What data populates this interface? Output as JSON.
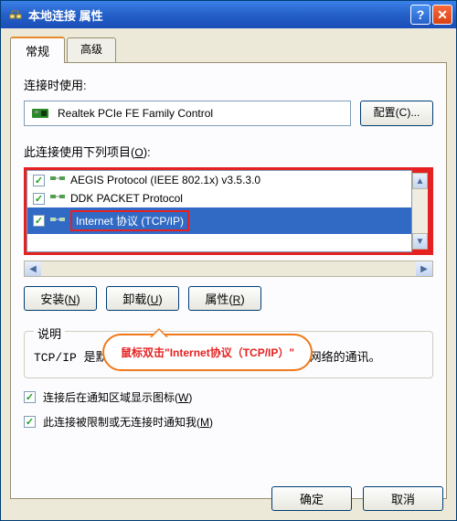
{
  "titlebar": {
    "title": "本地连接 属性"
  },
  "tabs": {
    "general": "常规",
    "advanced": "高级"
  },
  "labels": {
    "connect_using": "连接时使用:",
    "items_used": "此连接使用下列项目(O):"
  },
  "adapter": {
    "name": "Realtek PCIe FE Family Control",
    "configure_btn": "配置(C)..."
  },
  "protocols": [
    {
      "checked": true,
      "label": "AEGIS Protocol (IEEE 802.1x) v3.5.3.0",
      "selected": false
    },
    {
      "checked": true,
      "label": "DDK PACKET Protocol",
      "selected": false
    },
    {
      "checked": true,
      "label": "Internet 协议 (TCP/IP)",
      "selected": true
    }
  ],
  "buttons": {
    "install": "安装(N)",
    "uninstall": "卸载(U)",
    "properties": "属性(R)"
  },
  "callout": {
    "text": "鼠标双击\"Internet协议（TCP/IP）\""
  },
  "description": {
    "heading": "说明",
    "text": "TCP/IP 是默认的广域网协议。它提供跨越多种互联网络的通讯。"
  },
  "checkboxes": {
    "show_icon": "连接后在通知区域显示图标(W)",
    "notify_limited": "此连接被限制或无连接时通知我(M)"
  },
  "footer": {
    "ok": "确定",
    "cancel": "取消"
  }
}
